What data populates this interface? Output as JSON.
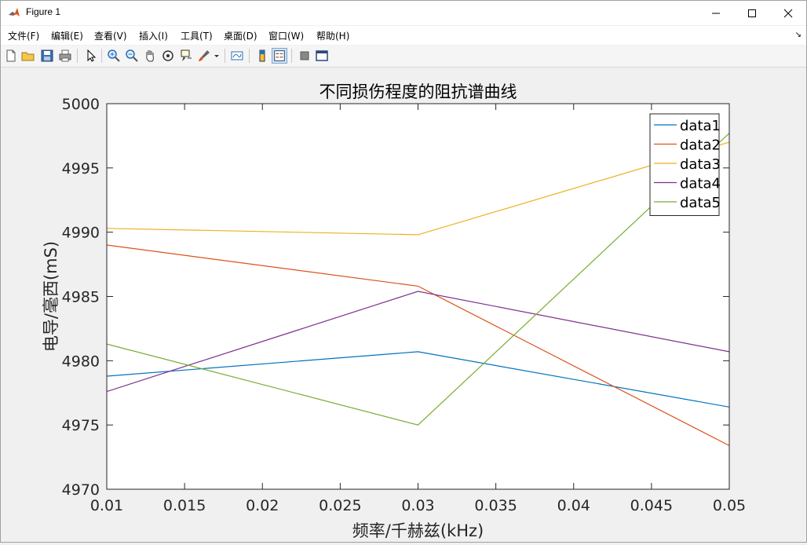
{
  "window": {
    "title": "Figure 1"
  },
  "menu": [
    "文件(F)",
    "编辑(E)",
    "查看(V)",
    "插入(I)",
    "工具(T)",
    "桌面(D)",
    "窗口(W)",
    "帮助(H)"
  ],
  "toolbar_icons": [
    "new-figure-icon",
    "open-file-icon",
    "save-icon",
    "print-icon",
    "pointer-icon",
    "zoom-in-icon",
    "zoom-out-icon",
    "pan-icon",
    "rotate-3d-icon",
    "data-cursor-icon",
    "brush-icon",
    "brush-dropdown-icon",
    "link-plot-icon",
    "colorbar-icon",
    "legend-icon",
    "hide-plot-tools-icon",
    "show-plot-tools-icon"
  ],
  "chart_data": {
    "type": "line",
    "title": "不同损伤程度的阻抗谱曲线",
    "xlabel": "频率/千赫兹(kHz)",
    "ylabel": "电导/毫西(mS)",
    "x": [
      0.01,
      0.03,
      0.05
    ],
    "xlim": [
      0.01,
      0.05
    ],
    "ylim": [
      4970,
      5000
    ],
    "xticks": [
      "0.01",
      "0.015",
      "0.02",
      "0.025",
      "0.03",
      "0.035",
      "0.04",
      "0.045",
      "0.05"
    ],
    "yticks": [
      "4970",
      "4975",
      "4980",
      "4985",
      "4990",
      "4995",
      "5000"
    ],
    "grid": false,
    "legend_position": "top-right",
    "series": [
      {
        "name": "data1",
        "color": "#0072bd",
        "values": [
          4978.8,
          4980.7,
          4976.4
        ]
      },
      {
        "name": "data2",
        "color": "#d95319",
        "values": [
          4989.0,
          4985.8,
          4973.4
        ]
      },
      {
        "name": "data3",
        "color": "#edb120",
        "values": [
          4990.3,
          4989.8,
          4997.0
        ]
      },
      {
        "name": "data4",
        "color": "#7e2f8e",
        "values": [
          4977.6,
          4985.4,
          4980.7
        ]
      },
      {
        "name": "data5",
        "color": "#77ac30",
        "values": [
          4981.3,
          4975.0,
          4997.7
        ]
      }
    ]
  }
}
